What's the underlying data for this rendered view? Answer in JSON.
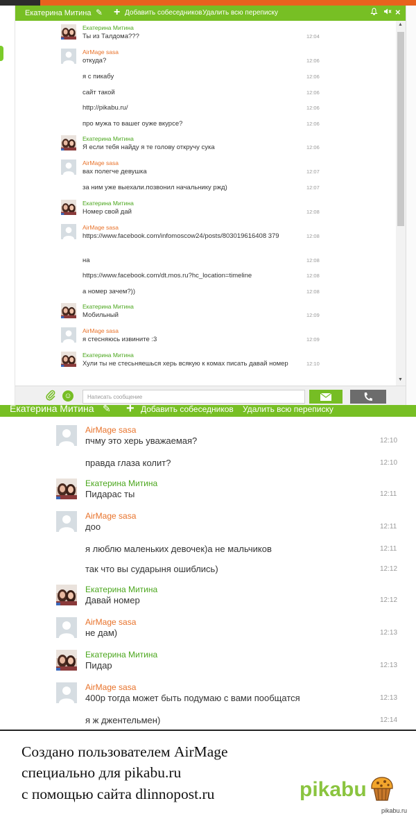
{
  "colors": {
    "accent": "#77bf24",
    "author_green": "#4aa61c",
    "author_orange": "#e8722a",
    "time": "#999999",
    "text": "#333333"
  },
  "chat1": {
    "header": {
      "contact_name": "Екатерина Митина",
      "add_label": "Добавить собеседников",
      "delete_label": "Удалить всю переписку"
    },
    "icons": {
      "edit": "✎",
      "plus": "+",
      "bell": "bell-icon",
      "mute": "speaker-mute-icon",
      "close": "×"
    },
    "messages": [
      {
        "author": "Екатерина Митина",
        "author_color": "green",
        "avatar": "photo",
        "text": "Ты из Талдома???",
        "time": "12:04"
      },
      {
        "author": "AirMage sasa",
        "author_color": "orange",
        "avatar": "placeholder",
        "text": "откуда?",
        "time": "12:06"
      },
      {
        "text": "я с пикабу",
        "time": "12:06"
      },
      {
        "text": "сайт такой",
        "time": "12:06"
      },
      {
        "text": "http://pikabu.ru/",
        "time": "12:06"
      },
      {
        "text": "про мужа то вашег оуже вкурсе?",
        "time": "12:06"
      },
      {
        "author": "Екатерина Митина",
        "author_color": "green",
        "avatar": "photo",
        "text": "Я если тебя найду я те голову откручу сука",
        "time": "12:06"
      },
      {
        "author": "AirMage sasa",
        "author_color": "orange",
        "avatar": "placeholder",
        "text": "вах полегче девушка",
        "time": "12:07"
      },
      {
        "text": "за ним уже выехали.позвонил начальнику ржд)",
        "time": "12:07"
      },
      {
        "author": "Екатерина Митина",
        "author_color": "green",
        "avatar": "photo",
        "text": "Номер свой дай",
        "time": "12:08"
      },
      {
        "author": "AirMage sasa",
        "author_color": "orange",
        "avatar": "placeholder",
        "text": "https://www.facebook.com/infomoscow24/posts/803019616408 379",
        "time": "12:08"
      },
      {
        "text": "на",
        "time": "12:08"
      },
      {
        "text": "https://www.facebook.com/dt.mos.ru?hc_location=timeline",
        "time": "12:08"
      },
      {
        "text": "а номер зачем?))",
        "time": "12:08"
      },
      {
        "author": "Екатерина Митина",
        "author_color": "green",
        "avatar": "photo",
        "text": "Мобильный",
        "time": "12:09"
      },
      {
        "author": "AirMage sasa",
        "author_color": "orange",
        "avatar": "placeholder",
        "text": "я стесняюсь извините :3",
        "time": "12:09"
      },
      {
        "author": "Екатерина Митина",
        "author_color": "green",
        "avatar": "photo",
        "text": "Хули ты не стесьняешься херь всякую к комах писать давай номер",
        "time": "12:10"
      }
    ],
    "input_placeholder": "Написать сообщение"
  },
  "chat2": {
    "header": {
      "contact_name": "Екатерина Митина",
      "add_label": "Добавить собеседников",
      "delete_label": "Удалить всю переписку"
    },
    "messages": [
      {
        "author": "AirMage sasa",
        "author_color": "orange",
        "avatar": "placeholder",
        "text": "пчму это херь уважаемая?",
        "time": "12:10"
      },
      {
        "text": "правда глаза колит?",
        "time": "12:10"
      },
      {
        "author": "Екатерина Митина",
        "author_color": "green",
        "avatar": "photo",
        "text": "Пидарас ты",
        "time": "12:11"
      },
      {
        "author": "AirMage sasa",
        "author_color": "orange",
        "avatar": "placeholder",
        "text": "доо",
        "time": "12:11"
      },
      {
        "text": "я люблю маленьких девочек)а не мальчиков",
        "time": "12:11"
      },
      {
        "text": "так что вы сударыня ошиблись)",
        "time": "12:12"
      },
      {
        "author": "Екатерина Митина",
        "author_color": "green",
        "avatar": "photo",
        "text": "Давай номер",
        "time": "12:12"
      },
      {
        "author": "AirMage sasa",
        "author_color": "orange",
        "avatar": "placeholder",
        "text": "не дам)",
        "time": "12:13"
      },
      {
        "author": "Екатерина Митина",
        "author_color": "green",
        "avatar": "photo",
        "text": "Пидар",
        "time": "12:13"
      },
      {
        "author": "AirMage sasa",
        "author_color": "orange",
        "avatar": "placeholder",
        "text": "400р тогда может быть подумаю с вами пообщатся",
        "time": "12:13"
      },
      {
        "text": "я ж джентельмен)",
        "time": "12:14"
      }
    ]
  },
  "footer": {
    "lines": [
      "Создано пользователем AirMage",
      "специально для pikabu.ru",
      "с помощью сайта dlinnopost.ru"
    ],
    "logo_text": "pikabu",
    "site": "pikabu.ru"
  }
}
